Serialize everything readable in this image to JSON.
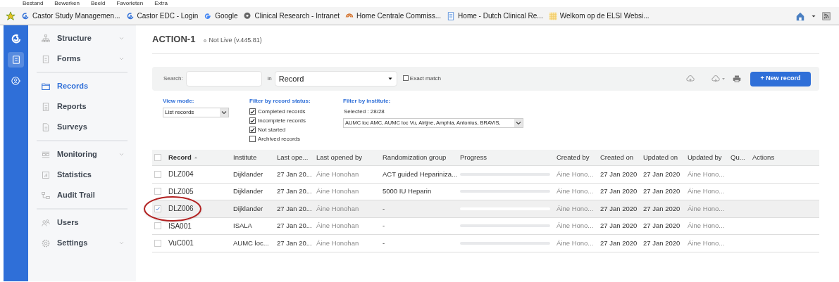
{
  "browser_menu": [
    "Bestand",
    "Bewerken",
    "Beeld",
    "Favorieten",
    "Extra"
  ],
  "favorites": [
    {
      "kind": "star"
    },
    {
      "kind": "castor",
      "label": "Castor Study Managemen..."
    },
    {
      "kind": "castor",
      "label": "Castor EDC - Login"
    },
    {
      "kind": "google",
      "label": "Google"
    },
    {
      "kind": "bubble",
      "label": "Clinical Research - Intranet"
    },
    {
      "kind": "swirl",
      "label": "Home  Centrale Commiss..."
    },
    {
      "kind": "page",
      "label": "Home - Dutch Clinical Re..."
    },
    {
      "kind": "grid",
      "label": "Welkom op de ELSI Websi..."
    }
  ],
  "rail_buttons": [
    {
      "kind": "book",
      "selected": true
    },
    {
      "kind": "user",
      "selected": false
    }
  ],
  "sidebar_groups": [
    [
      {
        "label": "Structure",
        "expandable": true,
        "selected": false
      },
      {
        "label": "Forms",
        "expandable": true,
        "selected": false
      }
    ],
    [
      {
        "label": "Records",
        "expandable": false,
        "selected": true
      },
      {
        "label": "Reports",
        "expandable": false,
        "selected": false
      },
      {
        "label": "Surveys",
        "expandable": false,
        "selected": false
      }
    ],
    [
      {
        "label": "Monitoring",
        "expandable": true,
        "selected": false
      },
      {
        "label": "Statistics",
        "expandable": false,
        "selected": false
      },
      {
        "label": "Audit Trail",
        "expandable": false,
        "selected": false
      }
    ],
    [
      {
        "label": "Users",
        "expandable": false,
        "selected": false
      },
      {
        "label": "Settings",
        "expandable": true,
        "selected": false
      }
    ]
  ],
  "study": {
    "title": "ACTION-1",
    "status": "Not Live (v.445.81)"
  },
  "search": {
    "label": "Search:",
    "in_label": "in",
    "field": "Record",
    "exact_match": {
      "label": "Exact match",
      "checked": false
    },
    "new_button": "+ New record"
  },
  "view_mode": {
    "heading": "View mode:",
    "value": "List records"
  },
  "status_filter": {
    "heading": "Filter by record status:",
    "options": [
      {
        "label": "Completed records",
        "checked": true
      },
      {
        "label": "Incomplete records",
        "checked": true
      },
      {
        "label": "Not started",
        "checked": true
      },
      {
        "label": "Archived records",
        "checked": false
      }
    ]
  },
  "institute_filter": {
    "heading": "Filter by institute:",
    "selected_text": "Selected : 28/28",
    "value": "AUMC loc AMC, AUMC loc Vu, Alrijne, Amphia, Antonius, BRAVIS,"
  },
  "table": {
    "select_all": {
      "checked": false
    },
    "columns": [
      "Record",
      "Institute",
      "Last ope...",
      "Last opened by",
      "Randomization group",
      "Progress",
      "Created by",
      "Created on",
      "Updated on",
      "Updated by",
      "Qu...",
      "Actions"
    ],
    "rows": [
      {
        "record": "DLZ004",
        "institute": "Dijklander",
        "last_opened": "27 Jan 20...",
        "last_opened_by": "Áine Honohan",
        "randomization": "ACT guided Hepariniza...",
        "level": 0,
        "created_by": "Áine Hono...",
        "created_on": "27 Jan 2020",
        "updated_on": "27 Jan 2020",
        "updated_by": "Áine Hono...",
        "selected": false,
        "circled": false
      },
      {
        "record": "DLZ005",
        "institute": "Dijklander",
        "last_opened": "27 Jan 20...",
        "last_opened_by": "Áine Honohan",
        "randomization": "5000 IU Heparin",
        "level": 0,
        "created_by": "Áine Hono...",
        "created_on": "27 Jan 2020",
        "updated_on": "27 Jan 2020",
        "updated_by": "Áine Hono...",
        "selected": false,
        "circled": false
      },
      {
        "record": "DLZ006",
        "institute": "Dijklander",
        "last_opened": "27 Jan 20...",
        "last_opened_by": "Áine Honohan",
        "randomization": "-",
        "level": 0,
        "created_by": "Áine Hono...",
        "created_on": "27 Jan 2020",
        "updated_on": "27 Jan 2020",
        "updated_by": "Áine Hono...",
        "selected": true,
        "circled": true
      },
      {
        "record": "ISA001",
        "institute": "ISALA",
        "last_opened": "27 Jan 20...",
        "last_opened_by": "Áine Honohan",
        "randomization": "-",
        "level": 0,
        "created_by": "Áine Hono...",
        "created_on": "27 Jan 2020",
        "updated_on": "27 Jan 2020",
        "updated_by": "Áine Hono...",
        "selected": false,
        "circled": false
      },
      {
        "record": "VuC001",
        "institute": "AUMC loc...",
        "last_opened": "27 Jan 20...",
        "last_opened_by": "Áine Honohan",
        "randomization": "-",
        "level": 0,
        "created_by": "Áine Hono...",
        "created_on": "27 Jan 2020",
        "updated_on": "27 Jan 2020",
        "updated_by": "Áine Hono...",
        "selected": false,
        "circled": false
      }
    ]
  }
}
